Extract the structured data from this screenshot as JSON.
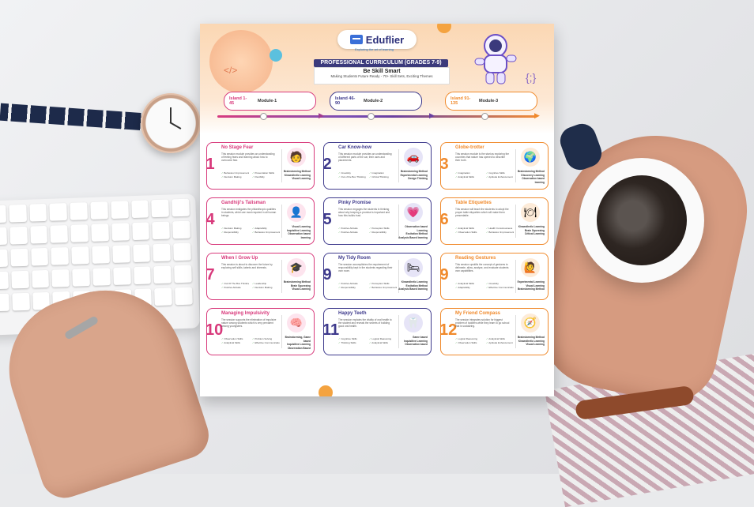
{
  "document": {
    "brand": "Eduflier",
    "brand_tagline": "Exploring the art of learning",
    "banner": "PROFESSIONAL CURRICULUM (GRADES 7-9)",
    "subtitle": "Be Skill Smart",
    "tagline": "Making Students Future Ready - 70+ Skill Sets, Exciting Themes",
    "islands": [
      {
        "island": "Island 1-45",
        "module": "Module-1",
        "color": "#d8397b"
      },
      {
        "island": "Island 46-90",
        "module": "Module-2",
        "color": "#3e3a8c"
      },
      {
        "island": "Island 91-135",
        "module": "Module-3",
        "color": "#f08a2c"
      }
    ],
    "cards": [
      {
        "num": "1",
        "title": "No Stage Fear",
        "theme": "pink",
        "icon": "person-speaking-icon",
        "glyph": "🧑",
        "desc": "This session module provides an understanding of feeling fears and learning about how to overcome fear.",
        "skills": [
          "Behaviour Improvement",
          "Presentation Skills",
          "Decision Making",
          "Flexibility"
        ],
        "methods": [
          "Brainstorming Method",
          "Kinaesthetic Learning",
          "Visual Learning"
        ]
      },
      {
        "num": "2",
        "title": "Car Know-how",
        "theme": "blue",
        "icon": "car-icon",
        "glyph": "🚗",
        "desc": "This session module provides an understanding of different parts of the car, their uses and placements.",
        "skills": [
          "Creativity",
          "Imagination",
          "Out of the Box Thinking",
          "Critical Thinking"
        ],
        "methods": [
          "Brainstorming Method",
          "Experimental Learning",
          "Design Thinking"
        ]
      },
      {
        "num": "3",
        "title": "Globe-trotter",
        "theme": "orange",
        "icon": "globe-icon",
        "glyph": "🌍",
        "desc": "This session module is the start as exploring the countries that nature has opened to describe their truth.",
        "skills": [
          "Imagination",
          "Cognitive Skills",
          "Analytical Skills",
          "Aptitude Enhancement"
        ],
        "methods": [
          "Brainstorming Method",
          "Discovery Learning",
          "Observation based learning"
        ]
      },
      {
        "num": "4",
        "title": "Gandhiji's Talisman",
        "theme": "pink",
        "icon": "gandhi-portrait-icon",
        "glyph": "👤",
        "desc": "This session instigates the philanthropic qualities in students, which are most required in all human beings.",
        "skills": [
          "Decision Making",
          "Adaptability",
          "Responsibility",
          "Behaviour Improvement"
        ],
        "methods": [
          "Visual Learning",
          "Inquisitive Learning",
          "Observation based learning"
        ]
      },
      {
        "num": "5",
        "title": "Pinky Promise",
        "theme": "blue",
        "icon": "heart-hands-icon",
        "glyph": "💗",
        "desc": "This session engages the students in thinking about why keeping a promise is important and how this builds trust.",
        "skills": [
          "Positive Attitude",
          "Perception Skills",
          "Positive Attitude",
          "Responsibility"
        ],
        "methods": [
          "Observation based Learning",
          "Excitation Method",
          "Analysis Based learning"
        ]
      },
      {
        "num": "6",
        "title": "Table Etiquettes",
        "theme": "orange",
        "icon": "dining-plate-icon",
        "glyph": "🍽",
        "desc": "This session will teach the students to adopt the proper table etiquettes which will make them presentable.",
        "skills": [
          "Analytical Skills",
          "Health Consciousness",
          "Observation Skills",
          "Behaviour Improvement"
        ],
        "methods": [
          "Kinaesthetic Learning",
          "Brain Squeezing",
          "Critical Learning"
        ]
      },
      {
        "num": "7",
        "title": "When I Grow Up",
        "theme": "pink",
        "icon": "graduate-icon",
        "glyph": "🎓",
        "desc": "This session is about to discover the future by exploring self skills, talents and interests.",
        "skills": [
          "Out Of The Box Thinking",
          "Leadership",
          "Positive Attitude",
          "Decision Making"
        ],
        "methods": [
          "Brainstorming Method",
          "Brain Squeezing",
          "Visual Learning"
        ]
      },
      {
        "num": "9",
        "title": "My Tidy Room",
        "theme": "blue",
        "icon": "room-icon",
        "glyph": "🛏",
        "desc": "The session accomplishes the requirement of responsibility kept in the students regarding their own room.",
        "skills": [
          "Positive Attitude",
          "Perception Skills",
          "Responsibility",
          "Behaviour Improvement"
        ],
        "methods": [
          "Kinaesthetic Learning",
          "Excitation Method",
          "Analysis Based learning"
        ]
      },
      {
        "num": "9",
        "title": "Reading Gestures",
        "theme": "orange",
        "icon": "gestures-icon",
        "glyph": "🙋",
        "desc": "This session upskills the concept of gestures to delineate, allow, analyse, and evaluate students own capabilities.",
        "skills": [
          "Analytical Skills",
          "Creativity",
          "Adaptability",
          "Effective Communication"
        ],
        "methods": [
          "Experimental Learning",
          "Visual Learning",
          "Brainstorming Method"
        ]
      },
      {
        "num": "10",
        "title": "Managing Impulsivity",
        "theme": "pink",
        "icon": "brain-icon",
        "glyph": "🧠",
        "desc": "The session supports the elimination of impulsive nature among students which is very prevalent among youngsters.",
        "skills": [
          "Observation Skills",
          "Problem Solving",
          "Analytical Skills",
          "Effective Communication"
        ],
        "methods": [
          "Brainstorming, Game based",
          "Inquisitive Learning",
          "Observation Based"
        ]
      },
      {
        "num": "11",
        "title": "Happy Teeth",
        "theme": "blue",
        "icon": "tooth-icon",
        "glyph": "🦷",
        "desc": "The session explains the vitality of oral health to the student and reveals the secrets of building good oral health.",
        "skills": [
          "Cognitive Skills",
          "Logical Reasoning",
          "Thinking Skills",
          "Analytical Skills"
        ],
        "methods": [
          "Game based",
          "Inquisitive Learning",
          "Observation based"
        ]
      },
      {
        "num": "12",
        "title": "My Friend Compass",
        "theme": "orange",
        "icon": "compass-icon",
        "glyph": "🧭",
        "desc": "The session integrates solution for biggest problem of toddlers while they learn to go school that is socializing.",
        "skills": [
          "Logical Reasoning",
          "Analytical Skills",
          "Observation Skills",
          "Aptitude Enhancement"
        ],
        "methods": [
          "Brainstorming Method",
          "Kinaesthetic Learning",
          "Visual Learning"
        ]
      }
    ]
  }
}
